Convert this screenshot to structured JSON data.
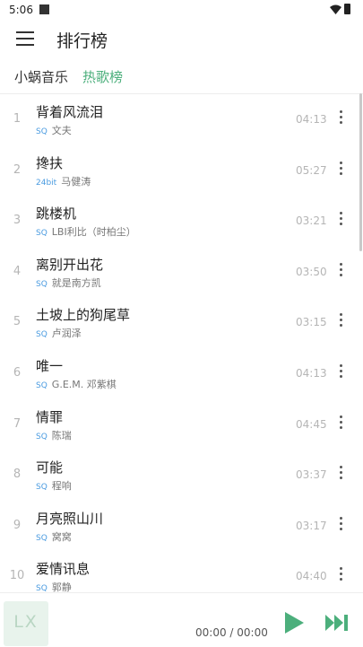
{
  "status_bar": {
    "time": "5:06"
  },
  "app_bar": {
    "title": "排行榜"
  },
  "tabs": {
    "source": "小蜗音乐",
    "active": "热歌榜"
  },
  "songs": [
    {
      "index": "1",
      "title": "背着风流泪",
      "quality": "SQ",
      "artist": "文夫",
      "duration": "04:13"
    },
    {
      "index": "2",
      "title": "搀扶",
      "quality": "24bit",
      "artist": "马健涛",
      "duration": "05:27"
    },
    {
      "index": "3",
      "title": "跳楼机",
      "quality": "SQ",
      "artist": "LBI利比（时柏尘）",
      "duration": "03:21"
    },
    {
      "index": "4",
      "title": "离别开出花",
      "quality": "SQ",
      "artist": "就是南方凯",
      "duration": "03:50"
    },
    {
      "index": "5",
      "title": "土坡上的狗尾草",
      "quality": "SQ",
      "artist": "卢润泽",
      "duration": "03:15"
    },
    {
      "index": "6",
      "title": "唯一",
      "quality": "SQ",
      "artist": "G.E.M. 邓紫棋",
      "duration": "04:13"
    },
    {
      "index": "7",
      "title": "情罪",
      "quality": "SQ",
      "artist": "陈瑞",
      "duration": "04:45"
    },
    {
      "index": "8",
      "title": "可能",
      "quality": "SQ",
      "artist": "程响",
      "duration": "03:37"
    },
    {
      "index": "9",
      "title": "月亮照山川",
      "quality": "SQ",
      "artist": "窝窝",
      "duration": "03:17"
    },
    {
      "index": "10",
      "title": "爱情讯息",
      "quality": "SQ",
      "artist": "郭静",
      "duration": "04:40"
    }
  ],
  "player": {
    "cover_text": "LX",
    "time": "00:00 / 00:00"
  },
  "icons": {
    "menu": "menu-icon",
    "more": "more-vertical-icon",
    "play": "play-icon",
    "next": "skip-next-icon",
    "wifi": "wifi-icon",
    "battery": "battery-icon"
  },
  "colors": {
    "accent": "#4caf7c",
    "quality": "#4a9be0"
  }
}
